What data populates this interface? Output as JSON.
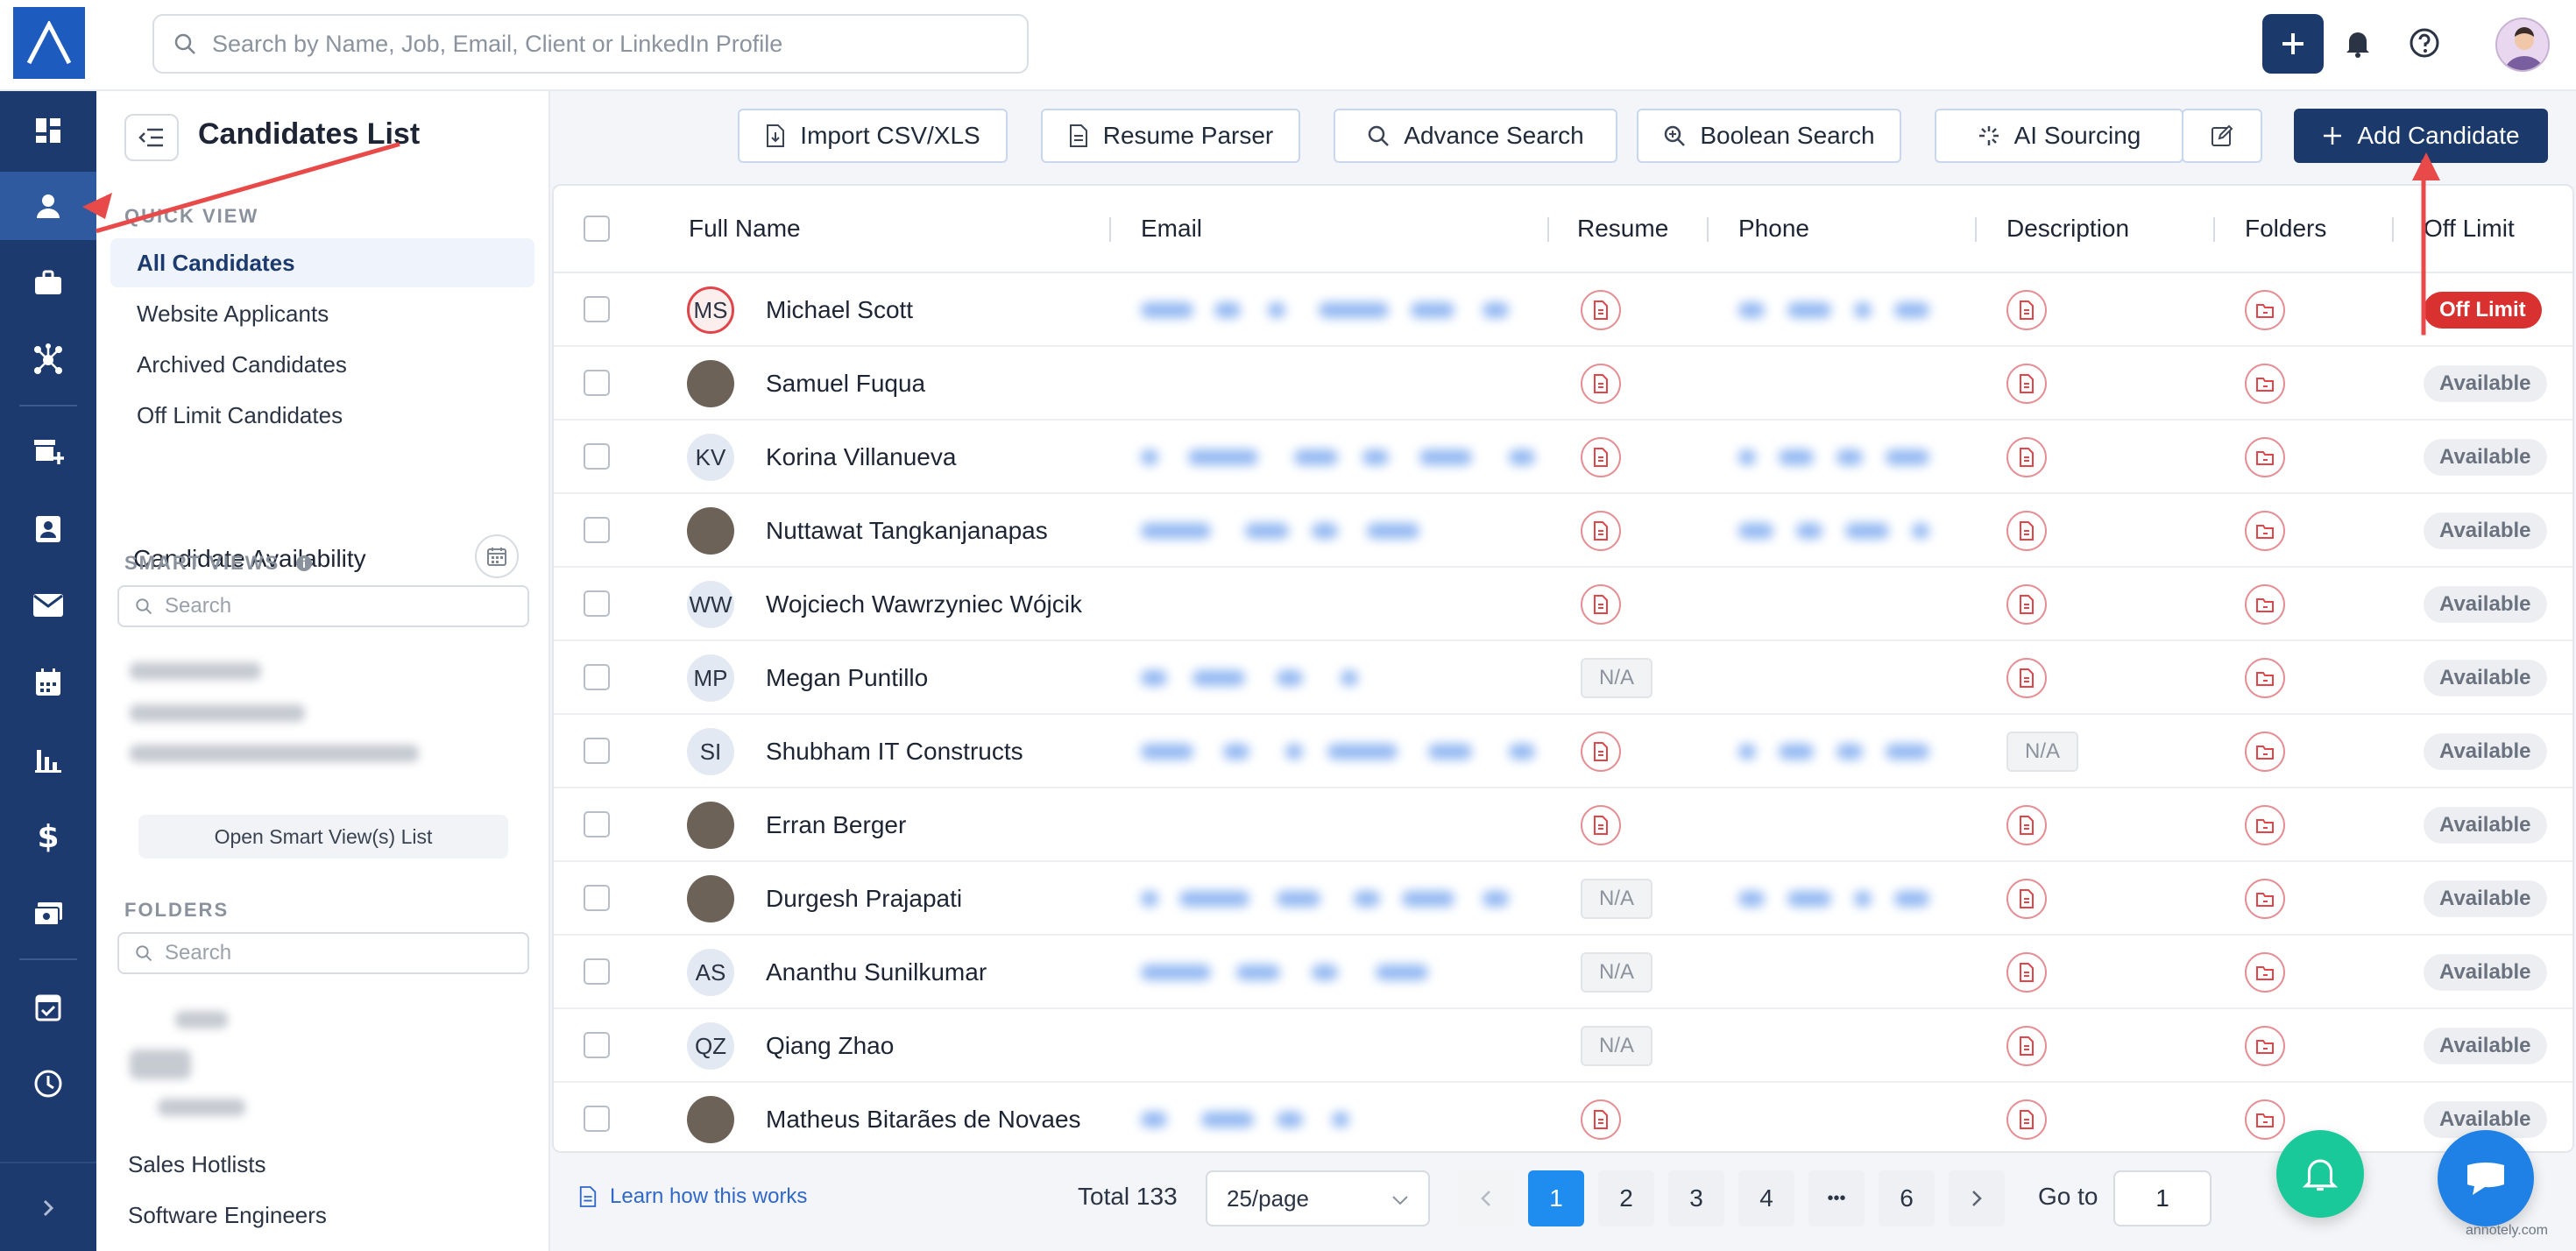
{
  "topbar": {
    "search_placeholder": "Search by Name, Job, Email, Client or LinkedIn Profile"
  },
  "page": {
    "title": "Candidates List"
  },
  "toolbar": {
    "import_label": "Import CSV/XLS",
    "resume_parser_label": "Resume Parser",
    "advance_search_label": "Advance Search",
    "boolean_search_label": "Boolean Search",
    "ai_sourcing_label": "AI Sourcing",
    "add_candidate_label": "Add Candidate"
  },
  "side": {
    "quick_view_label": "QUICK VIEW",
    "quick_view_items": [
      "All Candidates",
      "Website Applicants",
      "Archived Candidates",
      "Off Limit Candidates"
    ],
    "candidate_availability": "Candidate Availability",
    "smart_views_label": "SMART VIEWS",
    "smart_search_placeholder": "Search",
    "open_smart_views": "Open Smart View(s) List",
    "folders_label": "FOLDERS",
    "folder_search_placeholder": "Search",
    "folders": [
      "Sales Hotlists",
      "Software Engineers"
    ]
  },
  "table": {
    "columns": [
      "Full Name",
      "Email",
      "Resume",
      "Phone",
      "Description",
      "Folders",
      "Off Limit"
    ],
    "na": "N/A",
    "rows": [
      {
        "initials": "MS",
        "name": "Michael Scott",
        "resume": true,
        "description": true,
        "status": "Off Limit"
      },
      {
        "initials": "",
        "name": "Samuel Fuqua",
        "resume": true,
        "description": true,
        "status": "Available"
      },
      {
        "initials": "KV",
        "name": "Korina Villanueva",
        "resume": true,
        "description": true,
        "status": "Available"
      },
      {
        "initials": "",
        "name": "Nuttawat Tangkanjanapas",
        "resume": true,
        "description": true,
        "status": "Available"
      },
      {
        "initials": "WW",
        "name": "Wojciech Wawrzyniec Wójcik",
        "resume": true,
        "description": true,
        "status": "Available"
      },
      {
        "initials": "MP",
        "name": "Megan Puntillo",
        "resume": false,
        "description": true,
        "status": "Available"
      },
      {
        "initials": "SI",
        "name": "Shubham IT Constructs",
        "resume": true,
        "description": false,
        "status": "Available"
      },
      {
        "initials": "",
        "name": "Erran Berger",
        "resume": true,
        "description": true,
        "status": "Available"
      },
      {
        "initials": "",
        "name": "Durgesh Prajapati",
        "resume": false,
        "description": true,
        "status": "Available"
      },
      {
        "initials": "AS",
        "name": "Ananthu Sunilkumar",
        "resume": false,
        "description": true,
        "status": "Available"
      },
      {
        "initials": "QZ",
        "name": "Qiang Zhao",
        "resume": false,
        "description": true,
        "status": "Available"
      },
      {
        "initials": "",
        "name": "Matheus Bitarães de Novaes",
        "resume": true,
        "description": true,
        "status": "Available"
      }
    ]
  },
  "pager": {
    "learn_label": "Learn how this works",
    "total_label": "Total 133",
    "per_page": "25/page",
    "pages": [
      "1",
      "2",
      "3",
      "4",
      "•••",
      "6"
    ],
    "current_page": "1",
    "goto_label": "Go to",
    "goto_value": "1"
  },
  "watermark": "annotely.com",
  "colors": {
    "navy": "#1b3a6b",
    "rail": "#1c3a6e",
    "accent": "#1f8cf0",
    "off_limit": "#d93030",
    "doc_icon": "#e0454a"
  }
}
